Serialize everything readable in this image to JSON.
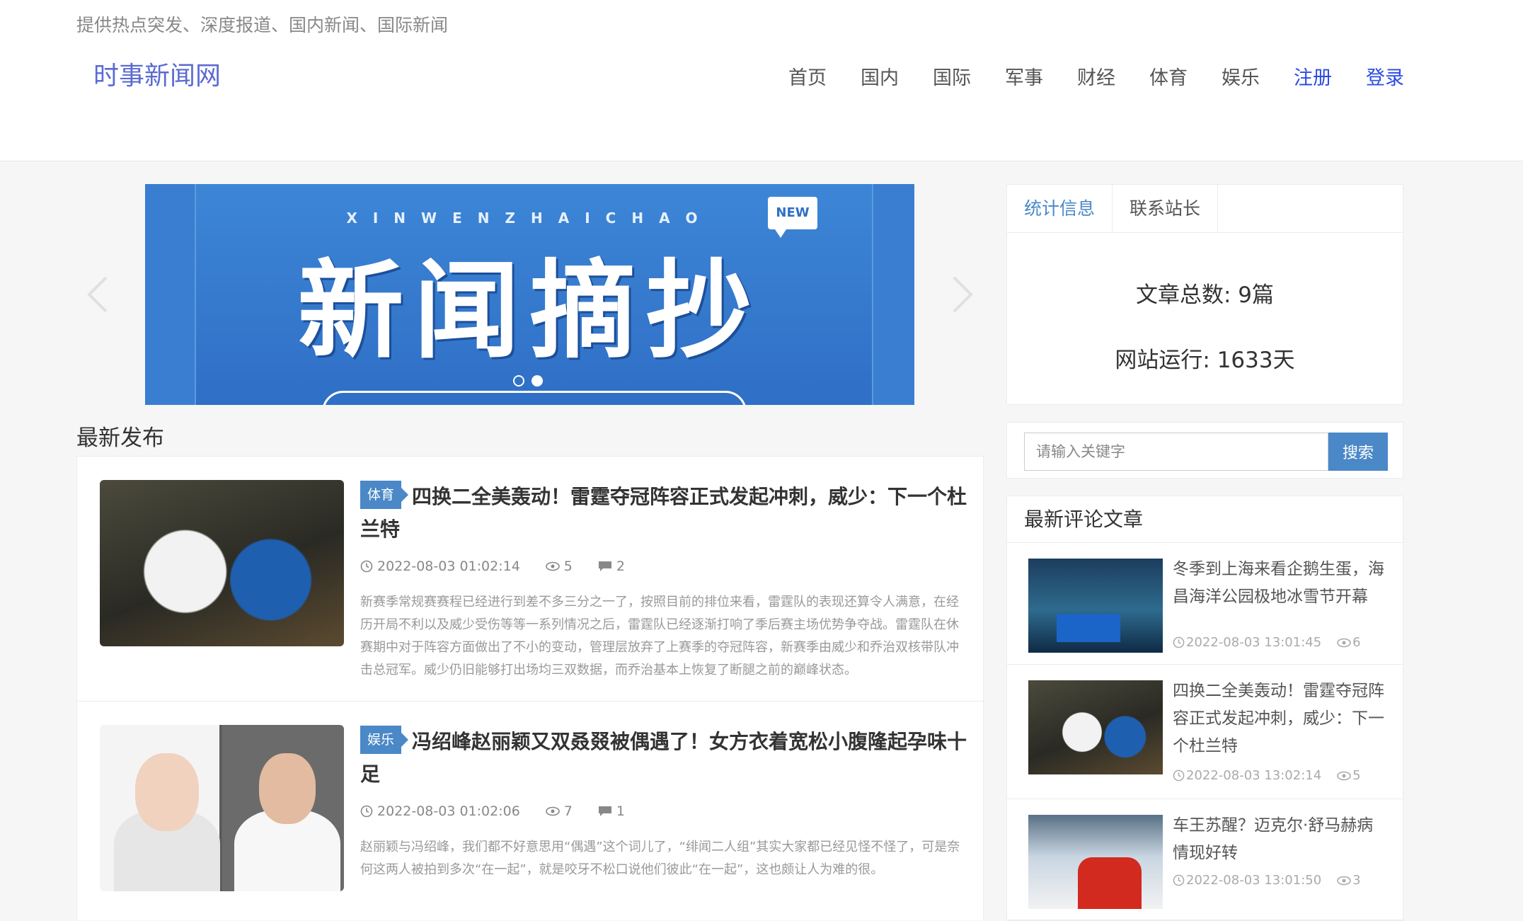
{
  "header": {
    "tagline": "提供热点突发、深度报道、国内新闻、国际新闻",
    "site_title": "时事新闻网",
    "nav": [
      "首页",
      "国内",
      "国际",
      "军事",
      "财经",
      "体育",
      "娱乐"
    ],
    "register": "注册",
    "login": "登录"
  },
  "carousel": {
    "pinyin": "XINWENZHAICHAO",
    "badge": "NEW",
    "title": "新闻摘抄",
    "slide_count": 2,
    "active_slide": 2
  },
  "latest": {
    "heading": "最新发布",
    "articles": [
      {
        "category": "体育",
        "title": "四换二全美轰动！雷霆夺冠阵容正式发起冲刺，威少：下一个杜兰特",
        "date": "2022-08-03 01:02:14",
        "views": "5",
        "comments": "2",
        "summary": "新赛季常规赛赛程已经进行到差不多三分之一了，按照目前的排位来看，雷霆队的表现还算令人满意，在经历开局不利以及威少受伤等等一系列情况之后，雷霆队已经逐渐打响了季后赛主场优势争夺战。雷霆队在休赛期中对于阵容方面做出了不小的变动，管理层放弃了上赛季的夺冠阵容，新赛季由威少和乔治双核带队冲击总冠军。威少仍旧能够打出场均三双数据，而乔治基本上恢复了断腿之前的巅峰状态。"
      },
      {
        "category": "娱乐",
        "title": "冯绍峰赵丽颖又双叒叕被偶遇了！女方衣着宽松小腹隆起孕味十足",
        "date": "2022-08-03 01:02:06",
        "views": "7",
        "comments": "1",
        "summary": "赵丽颖与冯绍峰，我们都不好意思用“偶遇”这个词儿了，“绯闻二人组”其实大家都已经见怪不怪了，可是奈何这两人被拍到多次“在一起”，就是咬牙不松口说他们彼此“在一起”，这也颇让人为难的很。"
      }
    ]
  },
  "sidebar": {
    "tabs": [
      "统计信息",
      "联系站长"
    ],
    "stats": {
      "articles": "文章总数: 9篇",
      "uptime": "网站运行: 1633天"
    },
    "search": {
      "placeholder": "请输入关键字",
      "button": "搜索"
    },
    "comments_heading": "最新评论文章",
    "comment_articles": [
      {
        "title": "冬季到上海来看企鹅生蛋，海昌海洋公园极地冰雪节开幕",
        "date": "2022-08-03 13:01:45",
        "views": "6"
      },
      {
        "title": "四换二全美轰动！雷霆夺冠阵容正式发起冲刺，威少：下一个杜兰特",
        "date": "2022-08-03 13:02:14",
        "views": "5"
      },
      {
        "title": "车王苏醒？迈克尔·舒马赫病情现好转",
        "date": "2022-08-03 13:01:50",
        "views": "3"
      }
    ]
  },
  "colors": {
    "accent": "#4a88c7",
    "site_title": "#5b6bd1",
    "account_links": "#2a4be3"
  }
}
